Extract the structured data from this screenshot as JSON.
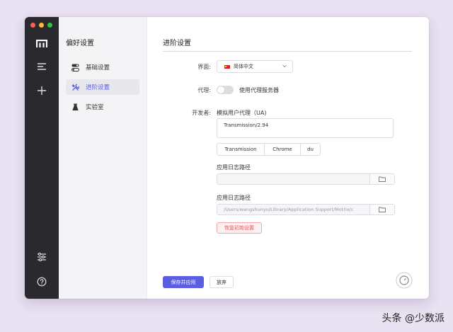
{
  "colors": {
    "accent": "#5b5ee0",
    "dock": "#2a2a2e",
    "danger": "#e05a5a"
  },
  "dock": {
    "logo_icon": "motrix-logo-icon",
    "items": [
      "menu-icon",
      "plus-icon"
    ],
    "bottom": [
      "sliders-icon",
      "help-icon"
    ]
  },
  "sidebar": {
    "title": "偏好设置",
    "items": [
      {
        "label": "基础设置",
        "icon": "toggle-icon"
      },
      {
        "label": "进阶设置",
        "icon": "tools-icon"
      },
      {
        "label": "实验室",
        "icon": "flask-icon"
      }
    ]
  },
  "main": {
    "title": "进阶设置",
    "interface_label": "界面:",
    "language_value": "简体中文",
    "proxy_label": "代理:",
    "proxy_text": "使用代理服务器",
    "dev_label": "开发者:",
    "ua_label": "模拟用户代理（UA)",
    "ua_value": "Transmission/2.94",
    "ua_presets": [
      "Transmission",
      "Chrome",
      "du"
    ],
    "log_path_label_1": "应用日志路径",
    "log_path_value_1": "",
    "log_path_label_2": "应用日志路径",
    "log_path_value_2": "/Users/wangshunyu/Library/Application Support/Motrix/c",
    "reset_label": "恢复初始设置",
    "save_label": "保存并应用",
    "discard_label": "放弃"
  },
  "watermark": "头条 @少数派"
}
